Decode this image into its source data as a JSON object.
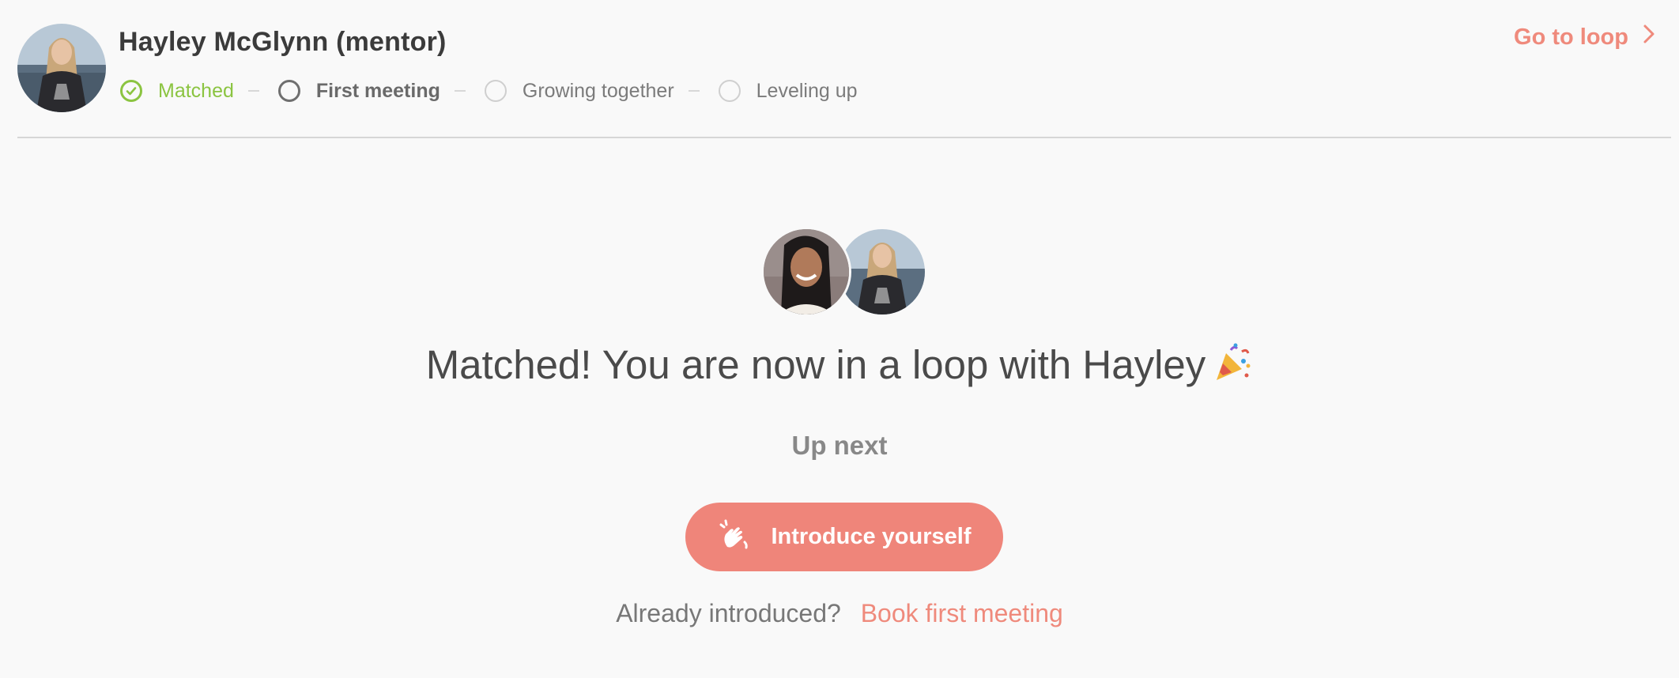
{
  "header": {
    "mentor_name": "Hayley McGlynn (mentor)",
    "go_to_loop": "Go to loop",
    "steps": [
      {
        "label": "Matched",
        "state": "done"
      },
      {
        "label": "First meeting",
        "state": "current"
      },
      {
        "label": "Growing together",
        "state": "todo"
      },
      {
        "label": "Leveling up",
        "state": "todo"
      }
    ]
  },
  "main": {
    "headline": "Matched! You are now in a loop with Hayley",
    "headline_emoji": "party-popper-icon",
    "up_next": "Up next",
    "introduce_button": "Introduce yourself",
    "already_text": "Already introduced?",
    "book_link": "Book first meeting"
  },
  "colors": {
    "accent": "#ef857a",
    "success": "#8bc441",
    "text_dark": "#3b3b3b",
    "background": "#f9f9f9"
  }
}
